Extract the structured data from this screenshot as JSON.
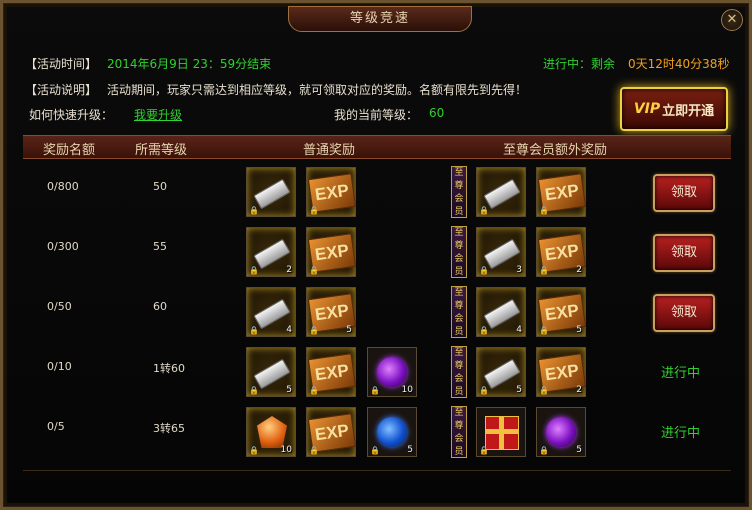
{
  "window": {
    "title": "等级竞速",
    "close_glyph": "✕"
  },
  "info": {
    "time_label": "【活动时间】",
    "time_value": "2014年6月9日 23：59分结束",
    "status_prefix": "进行中：剩余",
    "countdown": "0天12时40分38秒",
    "desc_label": "【活动说明】",
    "desc_text": "活动期间，玩家只需达到相应等级，就可领取对应的奖励。名额有限先到先得！",
    "quick_label": "如何快速升级：",
    "quick_link": "我要升级",
    "level_label": "我的当前等级：",
    "level_value": "60"
  },
  "vip_button": {
    "vip": "VIP",
    "label": "立即开通"
  },
  "table": {
    "headers": [
      "奖励名额",
      "所需等级",
      "普通奖励",
      "至尊会员额外奖励"
    ],
    "vip_tag": "至尊会员",
    "claim_label": "领取",
    "rows": [
      {
        "quota": "0/800",
        "level": "50",
        "normal": [
          {
            "icon": "silver-bar",
            "qty": ""
          },
          {
            "icon": "exp-scroll",
            "qty": ""
          }
        ],
        "vip": [
          {
            "icon": "silver-bar",
            "qty": ""
          },
          {
            "icon": "exp-scroll",
            "qty": ""
          }
        ],
        "action": "claim"
      },
      {
        "quota": "0/300",
        "level": "55",
        "normal": [
          {
            "icon": "silver-bar",
            "qty": "2"
          },
          {
            "icon": "exp-scroll",
            "qty": ""
          }
        ],
        "vip": [
          {
            "icon": "silver-bar",
            "qty": "3"
          },
          {
            "icon": "exp-scroll",
            "qty": "2"
          }
        ],
        "action": "claim"
      },
      {
        "quota": "0/50",
        "level": "60",
        "normal": [
          {
            "icon": "silver-bar",
            "qty": "4"
          },
          {
            "icon": "exp-scroll",
            "qty": "5"
          }
        ],
        "vip": [
          {
            "icon": "silver-bar",
            "qty": "4"
          },
          {
            "icon": "exp-scroll",
            "qty": "5"
          }
        ],
        "action": "claim"
      },
      {
        "quota": "0/10",
        "level": "1转60",
        "normal": [
          {
            "icon": "silver-bar",
            "qty": "5"
          },
          {
            "icon": "exp-scroll",
            "qty": ""
          },
          {
            "icon": "purple-orb",
            "qty": "10"
          }
        ],
        "vip": [
          {
            "icon": "silver-bar",
            "qty": "5"
          },
          {
            "icon": "exp-scroll",
            "qty": "2"
          }
        ],
        "action": "status",
        "status": "进行中"
      },
      {
        "quota": "0/5",
        "level": "3转65",
        "normal": [
          {
            "icon": "orange-crystal",
            "qty": "10"
          },
          {
            "icon": "exp-scroll",
            "qty": ""
          },
          {
            "icon": "blue-orb",
            "qty": "5"
          }
        ],
        "vip": [
          {
            "icon": "gift-box",
            "qty": ""
          },
          {
            "icon": "purple-orb",
            "qty": "5"
          }
        ],
        "action": "status",
        "status": "进行中"
      }
    ]
  },
  "colors": {
    "accent_green": "#2fd12f",
    "gold_border": "#f0d040",
    "header_bg": "#5a2418"
  }
}
